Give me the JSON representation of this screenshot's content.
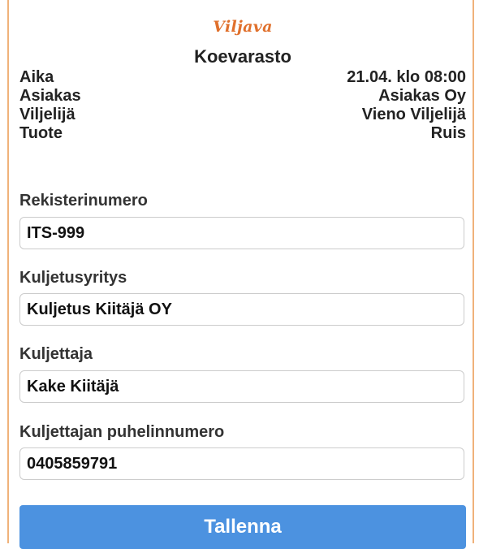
{
  "header": {
    "logo_text": "Viljava",
    "title": "Koevarasto"
  },
  "info": [
    {
      "label": "Aika",
      "value": "21.04. klo 08:00"
    },
    {
      "label": "Asiakas",
      "value": "Asiakas Oy"
    },
    {
      "label": "Viljelijä",
      "value": "Vieno Viljelijä"
    },
    {
      "label": "Tuote",
      "value": "Ruis"
    }
  ],
  "form": {
    "registration": {
      "label": "Rekisterinumero",
      "value": "ITS-999"
    },
    "company": {
      "label": "Kuljetusyritys",
      "value": "Kuljetus Kiitäjä OY"
    },
    "driver": {
      "label": "Kuljettaja",
      "value": "Kake Kiitäjä"
    },
    "phone": {
      "label": "Kuljettajan puhelinnumero",
      "value": "0405859791"
    }
  },
  "actions": {
    "save_label": "Tallenna"
  },
  "colors": {
    "accent_border": "#f0b27a",
    "logo": "#e0702c",
    "button": "#4c92e0"
  }
}
